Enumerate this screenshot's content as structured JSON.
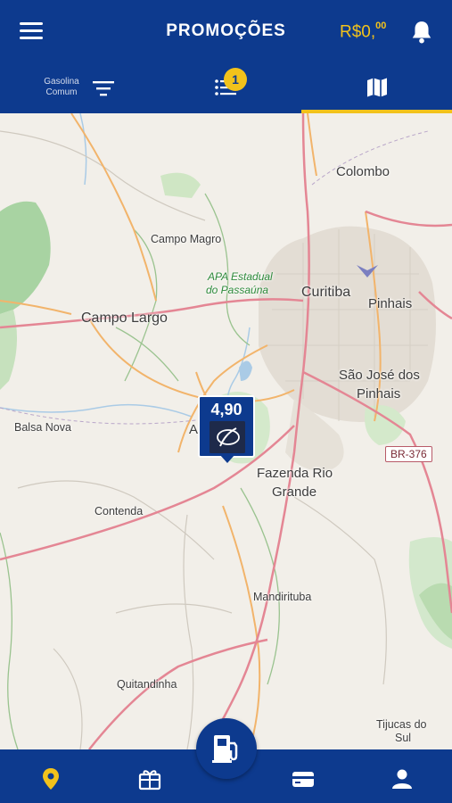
{
  "header": {
    "title": "PROMOÇÕES",
    "balance_main": "R$0,",
    "balance_cents": "00"
  },
  "subheader": {
    "fuel_type_line1": "Gasolina",
    "fuel_type_line2": "Comum",
    "list_badge_count": "1"
  },
  "map": {
    "places": {
      "colombo": "Colombo",
      "campo_magro": "Campo Magro",
      "apa_line1": "APA Estadual",
      "apa_line2": "do Passaúna",
      "curitiba": "Curitiba",
      "pinhais": "Pinhais",
      "campo_largo": "Campo Largo",
      "sao_jose_line1": "São José dos",
      "sao_jose_line2": "Pinhais",
      "balsa_nova": "Balsa Nova",
      "araucaria_partial": "A",
      "fazenda_line1": "Fazenda Rio",
      "fazenda_line2": "Grande",
      "contenda": "Contenda",
      "mandirituba": "Mandirituba",
      "quitandinha": "Quitandinha",
      "tijucas_line1": "Tijucas do",
      "tijucas_line2": "Sul"
    },
    "road_shield": "BR-376",
    "station_pin": {
      "price": "4,90"
    }
  },
  "colors": {
    "primary": "#0d3a8e",
    "accent": "#f2c21b"
  },
  "icons": {
    "menu": "hamburger-icon",
    "notifications": "bell-icon",
    "filter": "filter-icon",
    "list": "list-icon",
    "map": "map-icon",
    "location": "location-pin-icon",
    "gift": "gift-icon",
    "fuel": "fuel-pump-icon",
    "wallet": "wallet-icon",
    "profile": "user-icon"
  }
}
